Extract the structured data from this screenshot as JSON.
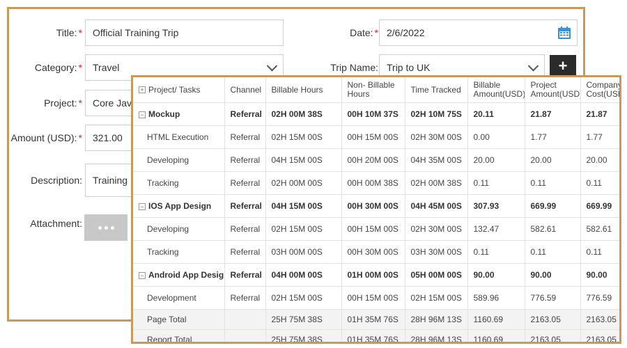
{
  "form": {
    "title_label": "Title:",
    "title_value": "Official Training Trip",
    "date_label": "Date:",
    "date_value": "2/6/2022",
    "category_label": "Category:",
    "category_value": "Travel",
    "trip_label": "Trip Name:",
    "trip_value": "Trip to UK",
    "project_label": "Project:",
    "project_value": "Core Jav",
    "amount_label": "Amount (USD):",
    "amount_value": "321.00",
    "description_label": "Description:",
    "description_value": "Training",
    "attachment_label": "Attachment:",
    "required_mark": "*",
    "add_button": "+"
  },
  "table": {
    "headers": [
      "Project/ Tasks",
      "Channel",
      "Billable Hours",
      "Non- Billable Hours",
      "Time Tracked",
      "Billable Amount(USD)",
      "Project Amount(USD)",
      "Company Cost(USD)"
    ],
    "rows": [
      {
        "type": "group",
        "name": "Mockup",
        "channel": "Referral",
        "billable": "02H 00M 38S",
        "nonbillable": "00H 10M 37S",
        "tracked": "02H 10M 75S",
        "bamount": "20.11",
        "pamount": "21.87",
        "ccost": "21.87"
      },
      {
        "type": "child",
        "name": "HTML Execution",
        "channel": "Referral",
        "billable": "02H 15M 00S",
        "nonbillable": "00H 15M 00S",
        "tracked": "02H 30M 00S",
        "bamount": "0.00",
        "pamount": "1.77",
        "ccost": "1.77"
      },
      {
        "type": "child",
        "name": "Developing",
        "channel": "Referral",
        "billable": "04H 15M 00S",
        "nonbillable": "00H 20M 00S",
        "tracked": "04H 35M 00S",
        "bamount": "20.00",
        "pamount": "20.00",
        "ccost": "20.00"
      },
      {
        "type": "child",
        "name": "Tracking",
        "channel": "Referral",
        "billable": "02H 00M 00S",
        "nonbillable": "00H 00M 38S",
        "tracked": "02H 00M 38S",
        "bamount": "0.11",
        "pamount": "0.11",
        "ccost": "0.11"
      },
      {
        "type": "group",
        "name": "IOS App Design",
        "channel": "Referral",
        "billable": "04H 15M 00S",
        "nonbillable": "00H 30M 00S",
        "tracked": "04H 45M 00S",
        "bamount": "307.93",
        "pamount": "669.99",
        "ccost": "669.99"
      },
      {
        "type": "child",
        "name": "Developing",
        "channel": "Referral",
        "billable": "02H 15M 00S",
        "nonbillable": "00H 15M 00S",
        "tracked": "02H 30M 00S",
        "bamount": "132.47",
        "pamount": "582.61",
        "ccost": "582.61"
      },
      {
        "type": "child",
        "name": "Tracking",
        "channel": "Referral",
        "billable": "03H 00M 00S",
        "nonbillable": "00H 30M 00S",
        "tracked": "03H 30M 00S",
        "bamount": "0.11",
        "pamount": "0.11",
        "ccost": "0.11"
      },
      {
        "type": "group",
        "name": "Android App Design",
        "channel": "Referral",
        "billable": "04H 00M 00S",
        "nonbillable": "01H 00M 00S",
        "tracked": "05H 00M 00S",
        "bamount": "90.00",
        "pamount": "90.00",
        "ccost": "90.00"
      },
      {
        "type": "child",
        "name": "Development",
        "channel": "Referral",
        "billable": "02H 15M 00S",
        "nonbillable": "00H 15M 00S",
        "tracked": "02H 15M 00S",
        "bamount": "589.96",
        "pamount": "776.59",
        "ccost": "776.59"
      },
      {
        "type": "total",
        "name": "Page Total",
        "channel": "",
        "billable": "25H 75M 38S",
        "nonbillable": "01H 35M 76S",
        "tracked": "28H 96M 13S",
        "bamount": "1160.69",
        "pamount": "2163.05",
        "ccost": "2163.05"
      },
      {
        "type": "total",
        "name": "Report Total",
        "channel": "",
        "billable": "25H 75M 38S",
        "nonbillable": "01H 35M 76S",
        "tracked": "28H 96M 13S",
        "bamount": "1160.69",
        "pamount": "2163.05",
        "ccost": "2163.05"
      }
    ]
  },
  "icons": {
    "calendar": "calendar-icon",
    "dropdown": "chevron-down-icon",
    "expand": "expand-icon",
    "collapse": "collapse-icon"
  },
  "colors": {
    "frame_border": "#c89a5a",
    "required": "#dd2222",
    "calendar": "#3a8fd8"
  }
}
